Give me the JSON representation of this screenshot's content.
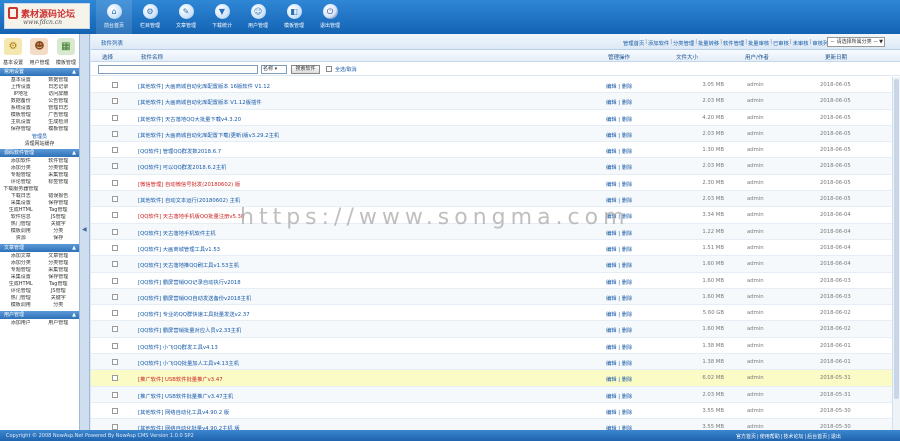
{
  "logo": {
    "name": "素材源码论坛",
    "url": "www.fdcn.cn"
  },
  "topnav": [
    {
      "label": "前台首页",
      "icon": "home-icon",
      "glyph": "⌂",
      "active": true
    },
    {
      "label": "栏目管理",
      "icon": "gear-icon",
      "glyph": "⚙"
    },
    {
      "label": "文章管理",
      "icon": "document-icon",
      "glyph": "✎"
    },
    {
      "label": "下载统计",
      "icon": "download-icon",
      "glyph": "▼"
    },
    {
      "label": "用户管理",
      "icon": "users-icon",
      "glyph": "☺"
    },
    {
      "label": "模板管理",
      "icon": "template-icon",
      "glyph": "◧"
    },
    {
      "label": "退出管理",
      "icon": "power-icon",
      "glyph": "⏻",
      "exit": true
    }
  ],
  "sidebar": {
    "tabs": [
      "基本设置",
      "用户管理",
      "模板管理"
    ],
    "sections": [
      {
        "title": "常用设置",
        "items": [
          "基本设置",
          "数据管理",
          "上传设置",
          "日志记录",
          "IP地址",
          "访问屏蔽",
          "数据备份",
          "公告管理",
          "系统设置",
          "管理日志",
          "模板管理",
          "广告管理",
          "主机设置",
          "生成检测",
          "保存管理",
          "模板管理"
        ],
        "subs": [
          {
            "label": "管理员",
            "hl": true
          },
          {
            "label": "清理网站缓存"
          }
        ]
      },
      {
        "title": "源码软件管理",
        "items": [
          "添加软件",
          "软件管理",
          "添加分类",
          "分类管理",
          "专题管理",
          "采集管理",
          "评论管理",
          "标签管理",
          "下载服务器管理",
          "",
          "下载日志",
          "错误报告",
          "采集设置",
          "保存管理",
          "生成HTML",
          "Tag管理",
          "软件信息",
          "JS管理",
          "热门管理",
          "关键字",
          "模板调用",
          "分类",
          "资源",
          "保存"
        ]
      },
      {
        "title": "文章管理",
        "items": [
          "添加文章",
          "文章管理",
          "添加分类",
          "分类管理",
          "专题管理",
          "采集管理",
          "采集设置",
          "保存管理",
          "生成HTML",
          "Tag管理",
          "评论管理",
          "JS管理",
          "热门管理",
          "关键字",
          "模板调用",
          "分类"
        ]
      },
      {
        "title": "用户管理",
        "items": [
          "添加用户",
          "用户管理"
        ]
      }
    ]
  },
  "main": {
    "page_title": "软件列表",
    "actions": [
      "管理首页",
      "添加软件",
      "分类管理",
      "批量转移",
      "软件管理",
      "批量审核",
      "已审核",
      "未审核",
      "审核列表"
    ],
    "category_select": "－ 请选择所属分类 －",
    "columns": {
      "select": "选择",
      "title": "软件名称",
      "ops": "管理操作",
      "size": "文件大小",
      "admin": "用户/作者",
      "date": "更新日期"
    },
    "search": {
      "field": "名称",
      "button": "搜索软件",
      "check_all_label": "全选/取消"
    },
    "rows": [
      {
        "title": "[其他软件] 大画商城自动化库配置版本 16版软件 V1.12",
        "size": "3.05 MB",
        "admin": "admin",
        "date": "2018-06-05",
        "ops": "编辑 | 删除"
      },
      {
        "title": "[其他软件] 大画商城自动化库配置版本 V1.12版插件",
        "size": "2.03 MB",
        "admin": "admin",
        "date": "2018-06-05",
        "ops": "编辑 | 删除"
      },
      {
        "title": "[其他软件] 天古落地QQ大批量下载v4.3.20",
        "size": "4.20 MB",
        "admin": "admin",
        "date": "2018-06-05",
        "ops": "编辑 | 删除"
      },
      {
        "title": "[其他软件] 大画商城自动化库配置下载(更新)版v3.29.2主机",
        "size": "2.03 MB",
        "admin": "admin",
        "date": "2018-06-05",
        "ops": "编辑 | 删除"
      },
      {
        "title": "[QQ软件] 管理QQ群发数2018.6.7",
        "size": "1.30 MB",
        "admin": "admin",
        "date": "2018-06-05",
        "ops": "编辑 | 删除"
      },
      {
        "title": "[QQ软件] 可以QQ群发2018.6.2主机",
        "size": "2.03 MB",
        "admin": "admin",
        "date": "2018-06-05",
        "ops": "编辑 | 删除"
      },
      {
        "title": "[微信管理] 自动微信号批发(20180602) 版",
        "size": "2.30 MB",
        "admin": "admin",
        "date": "2018-06-05",
        "ops": "编辑 | 删除",
        "red": true
      },
      {
        "title": "[其他软件] 自动文本运行(20180602) 主机",
        "size": "2.03 MB",
        "admin": "admin",
        "date": "2018-06-05",
        "ops": "编辑 | 删除"
      },
      {
        "title": "[QQ软件] 天古落地手机版QQ批量注册v5.38",
        "size": "3.34 MB",
        "admin": "admin",
        "date": "2018-06-04",
        "ops": "编辑 | 删除",
        "red": true
      },
      {
        "title": "[QQ软件] 天古落地手机软件主机",
        "size": "1.22 MB",
        "admin": "admin",
        "date": "2018-06-04",
        "ops": "编辑 | 删除"
      },
      {
        "title": "[QQ软件] 大画商城管理工具v1.53",
        "size": "1.51 MB",
        "admin": "admin",
        "date": "2018-06-04",
        "ops": "编辑 | 删除"
      },
      {
        "title": "[QQ软件] 天古落地推QQ刷工具v1.53主机",
        "size": "1.60 MB",
        "admin": "admin",
        "date": "2018-06-04",
        "ops": "编辑 | 删除"
      },
      {
        "title": "[QQ软件] 霸屏营销QQ记录自动执行v2018",
        "size": "1.60 MB",
        "admin": "admin",
        "date": "2018-06-03",
        "ops": "编辑 | 删除"
      },
      {
        "title": "[QQ软件] 霸屏营销QQ自动发送备份v2018主机",
        "size": "1.60 MB",
        "admin": "admin",
        "date": "2018-06-03",
        "ops": "编辑 | 删除"
      },
      {
        "title": "[QQ软件] 专业的QQ群快速工具批量发送v2.37",
        "size": "5.60 GB",
        "admin": "admin",
        "date": "2018-06-02",
        "ops": "编辑 | 删除"
      },
      {
        "title": "[QQ软件] 霸屏营销批量对应人员v2.33主机",
        "size": "1.60 MB",
        "admin": "admin",
        "date": "2018-06-02",
        "ops": "编辑 | 删除"
      },
      {
        "title": "[QQ软件] 小飞QQ群发工具v4.13",
        "size": "1.38 MB",
        "admin": "admin",
        "date": "2018-06-01",
        "ops": "编辑 | 删除"
      },
      {
        "title": "[QQ软件] 小飞QQ批量加人工具v4.13主机",
        "size": "1.38 MB",
        "admin": "admin",
        "date": "2018-06-01",
        "ops": "编辑 | 删除"
      },
      {
        "title": "[推广软件] USB软件批量推广v3.47",
        "size": "6.02 MB",
        "admin": "admin",
        "date": "2018-05-31",
        "ops": "编辑 | 删除",
        "red": true,
        "highlight": true
      },
      {
        "title": "[推广软件] USB软件批量推广v3.47主机",
        "size": "2.03 MB",
        "admin": "admin",
        "date": "2018-05-31",
        "ops": "编辑 | 删除"
      },
      {
        "title": "[其他软件] 网络自动化工具v4.90.2 版",
        "size": "3.55 MB",
        "admin": "admin",
        "date": "2018-05-30",
        "ops": "编辑 | 删除"
      },
      {
        "title": "[其他软件] 网络自动化批量v4.90.2主机 版",
        "size": "3.55 MB",
        "admin": "admin",
        "date": "2018-05-30",
        "ops": "编辑 | 删除"
      },
      {
        "title": "[QQ软件] 霸屏批量QQ v1.90",
        "size": "1.83 MB",
        "admin": "admin",
        "date": "2018-05-29",
        "ops": "编辑 | 删除",
        "red": true
      }
    ]
  },
  "footer": {
    "copyright": "Copyright © 2008 NowAsp.Net Powered By NowAsp CMS Version 1.0.0 SP2",
    "links": [
      "官方首页",
      "使用帮助",
      "技术论坛",
      "后台首页",
      "退出"
    ]
  },
  "watermark": "https://www.songma.com",
  "colors": {
    "header": "#1f6fc0",
    "link": "#1559a8",
    "highlight_row": "#fbfbc6",
    "alert_text": "#cc2222"
  }
}
